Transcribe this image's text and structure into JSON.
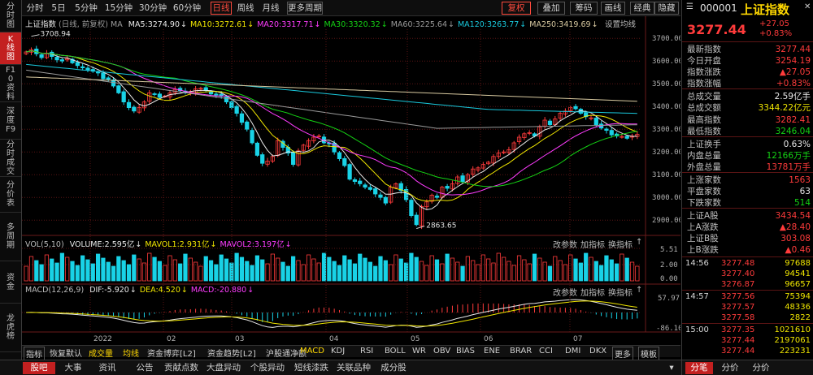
{
  "sidebar": {
    "items": [
      {
        "label": "分时图",
        "active": false
      },
      {
        "label": "K线图",
        "active": true
      },
      {
        "label": "F10资料",
        "active": false
      },
      {
        "label": "深度F9",
        "active": false
      },
      {
        "label": "分时成交",
        "active": false
      },
      {
        "label": "分价表",
        "active": false
      },
      {
        "label": "多周期",
        "active": false
      },
      {
        "label": "资金",
        "active": false
      },
      {
        "label": "龙虎榜",
        "active": false
      }
    ]
  },
  "toolbar": {
    "periods": [
      "分时",
      "5日",
      "5分钟",
      "15分钟",
      "30分钟",
      "60分钟",
      "日线",
      "周线",
      "月线",
      "更多周期"
    ],
    "active_period": "日线",
    "fuquan": "复权",
    "right_buttons": [
      "叠加",
      "筹码",
      "画线",
      "经典",
      "隐藏"
    ]
  },
  "kline": {
    "title": "上证指数",
    "mode": "(日线, 前复权)",
    "ma": [
      {
        "label": "MA5:3274.90",
        "color": "#e8e8e8"
      },
      {
        "label": "MA10:3272.61",
        "color": "#f0e600"
      },
      {
        "label": "MA20:3317.71",
        "color": "#ff3cff"
      },
      {
        "label": "MA30:3320.32",
        "color": "#14d214"
      },
      {
        "label": "MA60:3225.64",
        "color": "#9a9a9a"
      },
      {
        "label": "MA120:3263.77",
        "color": "#19c8dc"
      },
      {
        "label": "MA250:3419.69",
        "color": "#d8c9a0"
      }
    ],
    "settings": "设置均线",
    "high_label": "3708.94",
    "low_label": "2863.65",
    "y_ticks": [
      "3700.00",
      "3600.00",
      "3500.00",
      "3400.00",
      "3300.00",
      "3200.00",
      "3100.00",
      "3000.00",
      "2900.00"
    ]
  },
  "volume": {
    "title": "VOL(5,10)",
    "items": [
      {
        "label": "VOLUME:2.595亿",
        "color": "#e8e8e8"
      },
      {
        "label": "MAVOL1:2.931亿",
        "color": "#f0e600"
      },
      {
        "label": "MAVOL2:3.197亿",
        "color": "#ff3cff"
      }
    ],
    "y_ticks": [
      "5.51",
      "2.00",
      "0.00"
    ],
    "tools": [
      "改参数",
      "加指标",
      "换指标"
    ]
  },
  "macd": {
    "title": "MACD(12,26,9)",
    "items": [
      {
        "label": "DIF:-5.920",
        "color": "#e8e8e8"
      },
      {
        "label": "DEA:4.520",
        "color": "#f0e600"
      },
      {
        "label": "MACD:-20.880",
        "color": "#ff3cff"
      }
    ],
    "y_ticks": [
      "57.97",
      "-86.10"
    ],
    "tools": [
      "改参数",
      "加指标",
      "换指标"
    ]
  },
  "x_axis": [
    "2022",
    "02",
    "03",
    "04",
    "05",
    "06",
    "07"
  ],
  "indicator_bar": {
    "items": [
      "指标",
      "恢复默认",
      "成交量",
      "均线",
      "资金博弈[L2]",
      "资金趋势[L2]",
      "沪股通净额",
      "MACD",
      "KDJ",
      "RSI",
      "BOLL",
      "WR",
      "OBV",
      "BIAS",
      "ENE",
      "BRAR",
      "CCI",
      "DMI",
      "DKX",
      "更多",
      "模板"
    ]
  },
  "tabs": [
    "股吧",
    "大事",
    "资讯",
    "公告",
    "贡献点数",
    "大盘异动",
    "个股异动",
    "短线漆跌",
    "关联品种",
    "成分股"
  ],
  "quote": {
    "code": "000001",
    "name": "上证指数",
    "price": "3277.44",
    "change": "+27.05",
    "pct": "+0.83%",
    "rows": [
      {
        "label": "最新指数",
        "value": "3277.44",
        "color": "red"
      },
      {
        "label": "今日开盘",
        "value": "3254.19",
        "color": "red"
      },
      {
        "label": "指数涨跌",
        "value": "▲27.05",
        "color": "red"
      },
      {
        "label": "指数涨幅",
        "value": "+0.83%",
        "color": "red"
      },
      {
        "label": "总成交量",
        "value": "2.59亿手",
        "color": "white"
      },
      {
        "label": "总成交额",
        "value": "3344.22亿元",
        "color": "yellow"
      },
      {
        "label": "最高指数",
        "value": "3282.41",
        "color": "red"
      },
      {
        "label": "最低指数",
        "value": "3246.04",
        "color": "green"
      },
      {
        "label": "上证换手",
        "value": "0.63%",
        "color": "white"
      },
      {
        "label": "内盘总量",
        "value": "12166万手",
        "color": "green"
      },
      {
        "label": "外盘总量",
        "value": "13781万手",
        "color": "red"
      },
      {
        "label": "上涨家数",
        "value": "1563",
        "color": "red"
      },
      {
        "label": "平盘家数",
        "value": "63",
        "color": "white"
      },
      {
        "label": "下跌家数",
        "value": "514",
        "color": "green"
      },
      {
        "label": "上证A股",
        "value": "3434.54",
        "color": "red"
      },
      {
        "label": "上A涨跌",
        "value": "▲28.40",
        "color": "red"
      },
      {
        "label": "上证B股",
        "value": "303.08",
        "color": "red"
      },
      {
        "label": "上B涨跌",
        "value": "▲0.46",
        "color": "red"
      }
    ],
    "ticks": [
      {
        "time": "14:56",
        "price": "3277.48",
        "vol": "97688"
      },
      {
        "time": "",
        "price": "3277.40",
        "vol": "94541"
      },
      {
        "time": "",
        "price": "3276.87",
        "vol": "96657"
      },
      {
        "time": "14:57",
        "price": "3277.56",
        "vol": "75394"
      },
      {
        "time": "",
        "price": "3277.57",
        "vol": "48336"
      },
      {
        "time": "",
        "price": "3277.58",
        "vol": "2822"
      },
      {
        "time": "15:00",
        "price": "3277.35",
        "vol": "1021610"
      },
      {
        "time": "",
        "price": "3277.44",
        "vol": "2197061"
      },
      {
        "time": "",
        "price": "3277.44",
        "vol": "223231"
      }
    ],
    "tabs": [
      "分笔",
      "分价",
      "分价"
    ]
  },
  "chart_data": {
    "type": "candlestick",
    "ylim": [
      2840,
      3740
    ],
    "closes": [
      3640,
      3650,
      3632,
      3615,
      3635,
      3620,
      3605,
      3600,
      3610,
      3592,
      3580,
      3570,
      3560,
      3555,
      3548,
      3522,
      3520,
      3490,
      3460,
      3420,
      3395,
      3380,
      3395,
      3420,
      3460,
      3455,
      3440,
      3445,
      3460,
      3475,
      3470,
      3460,
      3465,
      3478,
      3480,
      3470,
      3455,
      3450,
      3445,
      3420,
      3395,
      3370,
      3330,
      3300,
      3240,
      3185,
      3150,
      3160,
      3180,
      3250,
      3220,
      3195,
      3145,
      3205,
      3230,
      3250,
      3265,
      3270,
      3240,
      3235,
      3200,
      3170,
      3140,
      3080,
      3070,
      3060,
      3045,
      3035,
      3015,
      3000,
      2975,
      3045,
      3060,
      3030,
      2990,
      2920,
      2880,
      2960,
      2980,
      3010,
      3000,
      3045,
      3040,
      3060,
      3090,
      3070,
      3100,
      3125,
      3130,
      3145,
      3155,
      3180,
      3195,
      3200,
      3210,
      3240,
      3265,
      3280,
      3285,
      3270,
      3310,
      3340,
      3320,
      3345,
      3370,
      3380,
      3395,
      3390,
      3370,
      3355,
      3350,
      3320,
      3305,
      3295,
      3275,
      3270,
      3268,
      3260,
      3270,
      3277
    ]
  }
}
